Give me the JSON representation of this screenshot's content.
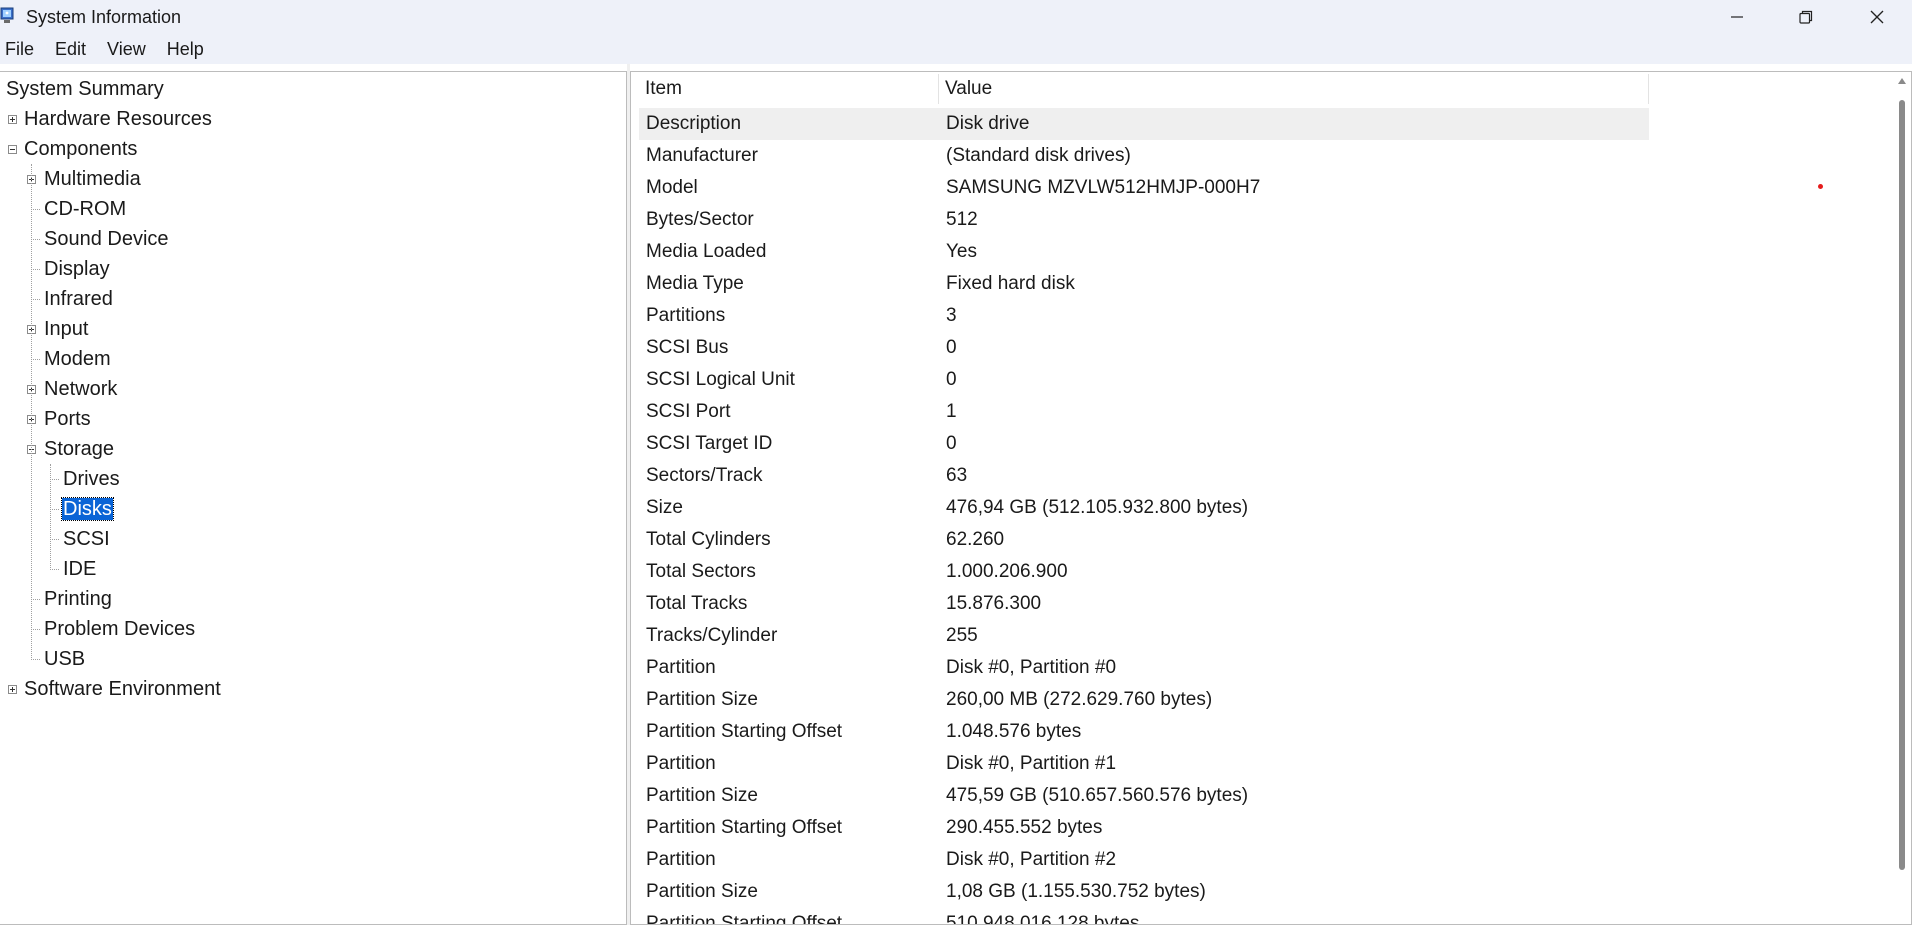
{
  "window": {
    "title": "System Information",
    "controls": [
      "minimize",
      "restore",
      "close"
    ]
  },
  "menu": [
    "File",
    "Edit",
    "View",
    "Help"
  ],
  "tree": [
    {
      "label": "System Summary",
      "level": 0,
      "expander": "none"
    },
    {
      "label": "Hardware Resources",
      "level": 0,
      "expander": "plus"
    },
    {
      "label": "Components",
      "level": 0,
      "expander": "minus"
    },
    {
      "label": "Multimedia",
      "level": 1,
      "expander": "plus"
    },
    {
      "label": "CD-ROM",
      "level": 1,
      "expander": "none"
    },
    {
      "label": "Sound Device",
      "level": 1,
      "expander": "none"
    },
    {
      "label": "Display",
      "level": 1,
      "expander": "none"
    },
    {
      "label": "Infrared",
      "level": 1,
      "expander": "none"
    },
    {
      "label": "Input",
      "level": 1,
      "expander": "plus"
    },
    {
      "label": "Modem",
      "level": 1,
      "expander": "none"
    },
    {
      "label": "Network",
      "level": 1,
      "expander": "plus"
    },
    {
      "label": "Ports",
      "level": 1,
      "expander": "plus"
    },
    {
      "label": "Storage",
      "level": 1,
      "expander": "minus"
    },
    {
      "label": "Drives",
      "level": 2,
      "expander": "none"
    },
    {
      "label": "Disks",
      "level": 2,
      "expander": "none",
      "selected": true
    },
    {
      "label": "SCSI",
      "level": 2,
      "expander": "none"
    },
    {
      "label": "IDE",
      "level": 2,
      "expander": "none"
    },
    {
      "label": "Printing",
      "level": 1,
      "expander": "none"
    },
    {
      "label": "Problem Devices",
      "level": 1,
      "expander": "none"
    },
    {
      "label": "USB",
      "level": 1,
      "expander": "none"
    },
    {
      "label": "Software Environment",
      "level": 0,
      "expander": "plus"
    }
  ],
  "table": {
    "headers": {
      "item": "Item",
      "value": "Value"
    },
    "rows": [
      {
        "item": "Description",
        "value": "Disk drive"
      },
      {
        "item": "Manufacturer",
        "value": "(Standard disk drives)"
      },
      {
        "item": "Model",
        "value": "SAMSUNG MZVLW512HMJP-000H7"
      },
      {
        "item": "Bytes/Sector",
        "value": "512"
      },
      {
        "item": "Media Loaded",
        "value": "Yes"
      },
      {
        "item": "Media Type",
        "value": "Fixed hard disk"
      },
      {
        "item": "Partitions",
        "value": "3"
      },
      {
        "item": "SCSI Bus",
        "value": "0"
      },
      {
        "item": "SCSI Logical Unit",
        "value": "0"
      },
      {
        "item": "SCSI Port",
        "value": "1"
      },
      {
        "item": "SCSI Target ID",
        "value": "0"
      },
      {
        "item": "Sectors/Track",
        "value": "63"
      },
      {
        "item": "Size",
        "value": "476,94 GB (512.105.932.800 bytes)"
      },
      {
        "item": "Total Cylinders",
        "value": "62.260"
      },
      {
        "item": "Total Sectors",
        "value": "1.000.206.900"
      },
      {
        "item": "Total Tracks",
        "value": "15.876.300"
      },
      {
        "item": "Tracks/Cylinder",
        "value": "255"
      },
      {
        "item": "Partition",
        "value": "Disk #0, Partition #0"
      },
      {
        "item": "Partition Size",
        "value": "260,00 MB (272.629.760 bytes)"
      },
      {
        "item": "Partition Starting Offset",
        "value": "1.048.576 bytes"
      },
      {
        "item": "Partition",
        "value": "Disk #0, Partition #1"
      },
      {
        "item": "Partition Size",
        "value": "475,59 GB (510.657.560.576 bytes)"
      },
      {
        "item": "Partition Starting Offset",
        "value": "290.455.552 bytes"
      },
      {
        "item": "Partition",
        "value": "Disk #0, Partition #2"
      },
      {
        "item": "Partition Size",
        "value": "1,08 GB (1.155.530.752 bytes)"
      },
      {
        "item": "Partition Starting Offset",
        "value": "510.948.016.128 bytes"
      }
    ]
  },
  "colors": {
    "chrome_bg": "#eef1f9",
    "selection": "#0a64d6",
    "row_highlight": "#efefef",
    "scroll_thumb": "#8a8a8a"
  }
}
